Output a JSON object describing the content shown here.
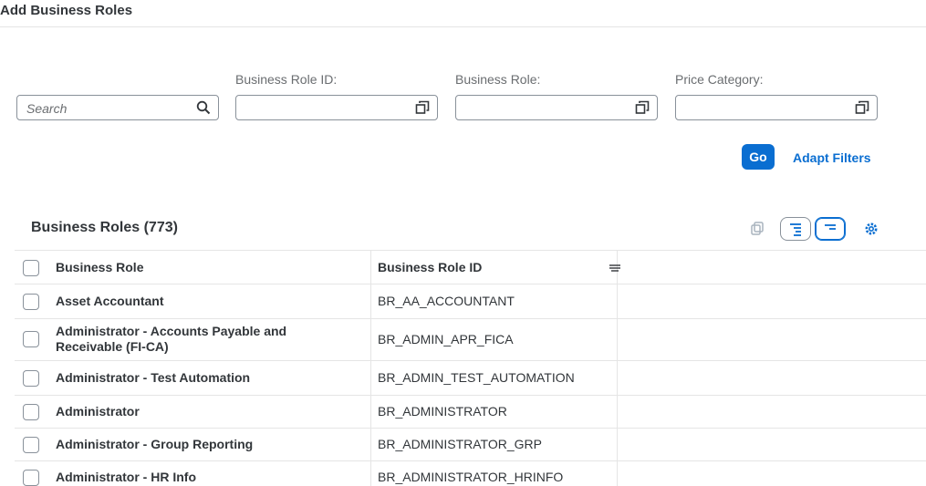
{
  "dialog": {
    "title": "Add Business Roles"
  },
  "filters": {
    "search_placeholder": "Search",
    "business_role_id_label": "Business Role ID:",
    "business_role_label": "Business Role:",
    "price_category_label": "Price Category:"
  },
  "actions": {
    "go_label": "Go",
    "adapt_filters_label": "Adapt Filters"
  },
  "table": {
    "title": "Business Roles (773)",
    "col_role": "Business Role",
    "col_id": "Business Role ID",
    "rows": [
      {
        "role": "Asset Accountant",
        "id": "BR_AA_ACCOUNTANT"
      },
      {
        "role": "Administrator - Accounts Payable and Receivable (FI-CA)",
        "id": "BR_ADMIN_APR_FICA"
      },
      {
        "role": "Administrator - Test Automation",
        "id": "BR_ADMIN_TEST_AUTOMATION"
      },
      {
        "role": "Administrator",
        "id": "BR_ADMINISTRATOR"
      },
      {
        "role": "Administrator - Group Reporting",
        "id": "BR_ADMINISTRATOR_GRP"
      },
      {
        "role": "Administrator - HR Info",
        "id": "BR_ADMINISTRATOR_HRINFO"
      }
    ]
  },
  "colors": {
    "accent": "#0a6ed1",
    "text": "#32363a",
    "border": "#89919a"
  },
  "icons": {
    "search": "search-icon",
    "value_help": "value-help-icon",
    "copy": "copy-icon",
    "expand": "expand-all-icon",
    "collapse": "collapse-all-icon",
    "settings": "settings-icon",
    "column_menu": "column-menu-icon"
  }
}
